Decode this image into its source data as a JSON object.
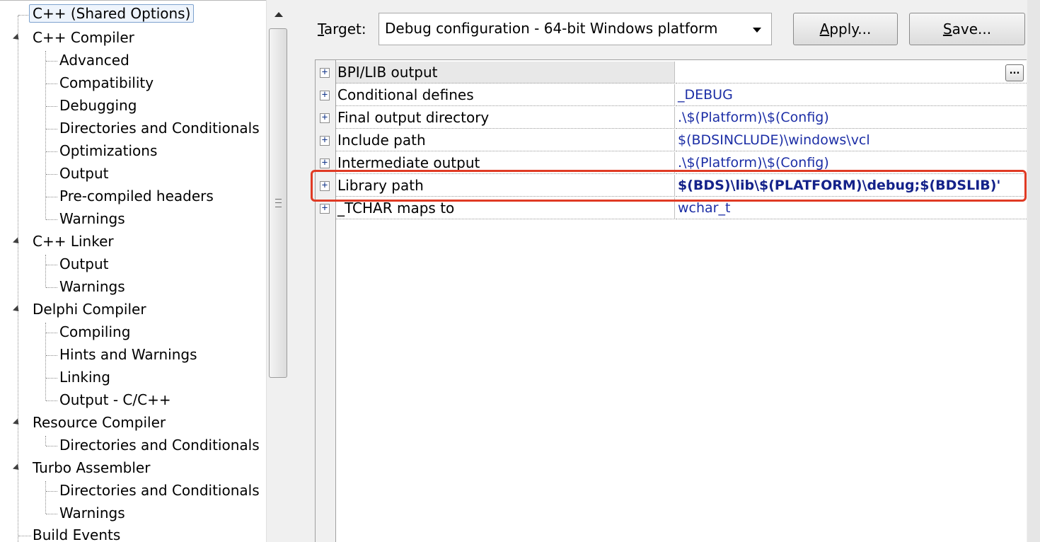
{
  "tree": {
    "items": [
      {
        "label": "C++ (Shared Options)",
        "selected": true
      },
      {
        "label": "C++ Compiler"
      },
      {
        "label": "Advanced"
      },
      {
        "label": "Compatibility"
      },
      {
        "label": "Debugging"
      },
      {
        "label": "Directories and Conditionals"
      },
      {
        "label": "Optimizations"
      },
      {
        "label": "Output"
      },
      {
        "label": "Pre-compiled headers"
      },
      {
        "label": "Warnings"
      },
      {
        "label": "C++ Linker"
      },
      {
        "label": "Output"
      },
      {
        "label": "Warnings"
      },
      {
        "label": "Delphi Compiler"
      },
      {
        "label": "Compiling"
      },
      {
        "label": "Hints and Warnings"
      },
      {
        "label": "Linking"
      },
      {
        "label": "Output - C/C++"
      },
      {
        "label": "Resource Compiler"
      },
      {
        "label": "Directories and Conditionals"
      },
      {
        "label": "Turbo Assembler"
      },
      {
        "label": "Directories and Conditionals"
      },
      {
        "label": "Warnings"
      },
      {
        "label": "Build Events"
      }
    ]
  },
  "toolbar": {
    "target_label_mnemonic": "T",
    "target_label_rest": "arget:",
    "target_value": "Debug configuration - 64-bit Windows platform",
    "apply_mnemonic": "A",
    "apply_rest": "pply...",
    "save_mnemonic": "S",
    "save_rest": "ave..."
  },
  "grid": {
    "ellipsis": "...",
    "rows": [
      {
        "name": "BPI/LIB output",
        "value": "",
        "expander": "+"
      },
      {
        "name": "Conditional defines",
        "value": "_DEBUG",
        "expander": "+"
      },
      {
        "name": "Final output directory",
        "value": ".\\$(Platform)\\$(Config)",
        "expander": "+"
      },
      {
        "name": "Include path",
        "value": "$(BDSINCLUDE)\\windows\\vcl",
        "expander": "+"
      },
      {
        "name": "Intermediate output",
        "value": ".\\$(Platform)\\$(Config)",
        "expander": "+"
      },
      {
        "name": "Library path",
        "value": "$(BDS)\\lib\\$(PLATFORM)\\debug;$(BDSLIB)'",
        "expander": "+"
      },
      {
        "name": "_TCHAR maps to",
        "value": "wchar_t",
        "expander": "+"
      }
    ]
  },
  "colors": {
    "highlight_border": "#e03a24",
    "value_text": "#1c2ea6",
    "selection_border": "#7da2ce"
  }
}
